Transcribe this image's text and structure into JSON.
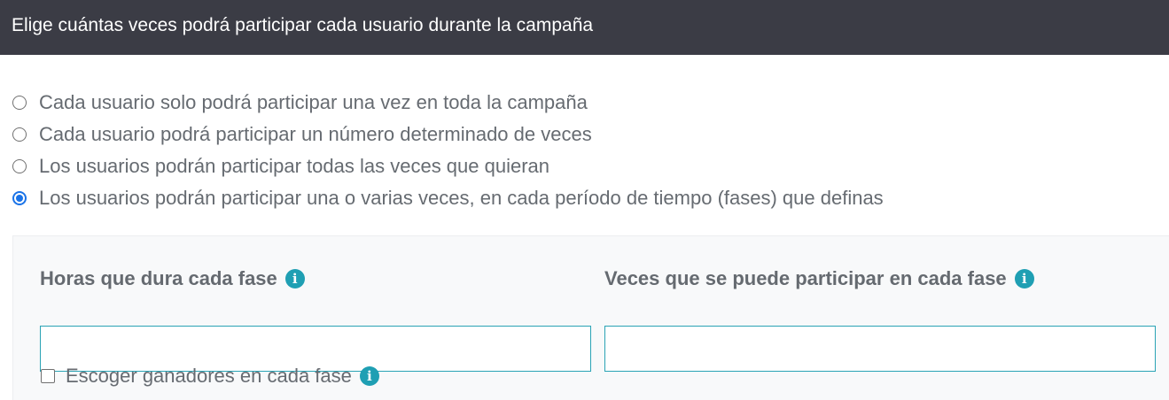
{
  "header": {
    "title": "Elige cuántas veces podrá participar cada usuario durante la campaña"
  },
  "participation_options": [
    {
      "label": "Cada usuario solo podrá participar una vez en toda la campaña",
      "selected": false
    },
    {
      "label": "Cada usuario podrá participar un número determinado de veces",
      "selected": false
    },
    {
      "label": "Los usuarios podrán participar todas las veces que quieran",
      "selected": false
    },
    {
      "label": "Los usuarios podrán participar una o varias veces, en cada período de tiempo (fases) que definas",
      "selected": true
    }
  ],
  "phases_panel": {
    "hours_field": {
      "label": "Horas que dura cada fase",
      "value": "",
      "info_icon": "info-icon"
    },
    "times_field": {
      "label": "Veces que se puede participar en cada fase",
      "value": "",
      "info_icon": "info-icon"
    },
    "winners_checkbox": {
      "label": "Escoger ganadores en cada fase",
      "checked": false,
      "info_icon": "info-icon"
    }
  },
  "colors": {
    "header_bg": "#3b3c45",
    "accent": "#1a73e8",
    "info_icon": "#1f9fb3",
    "input_border": "#2aa3b5"
  }
}
